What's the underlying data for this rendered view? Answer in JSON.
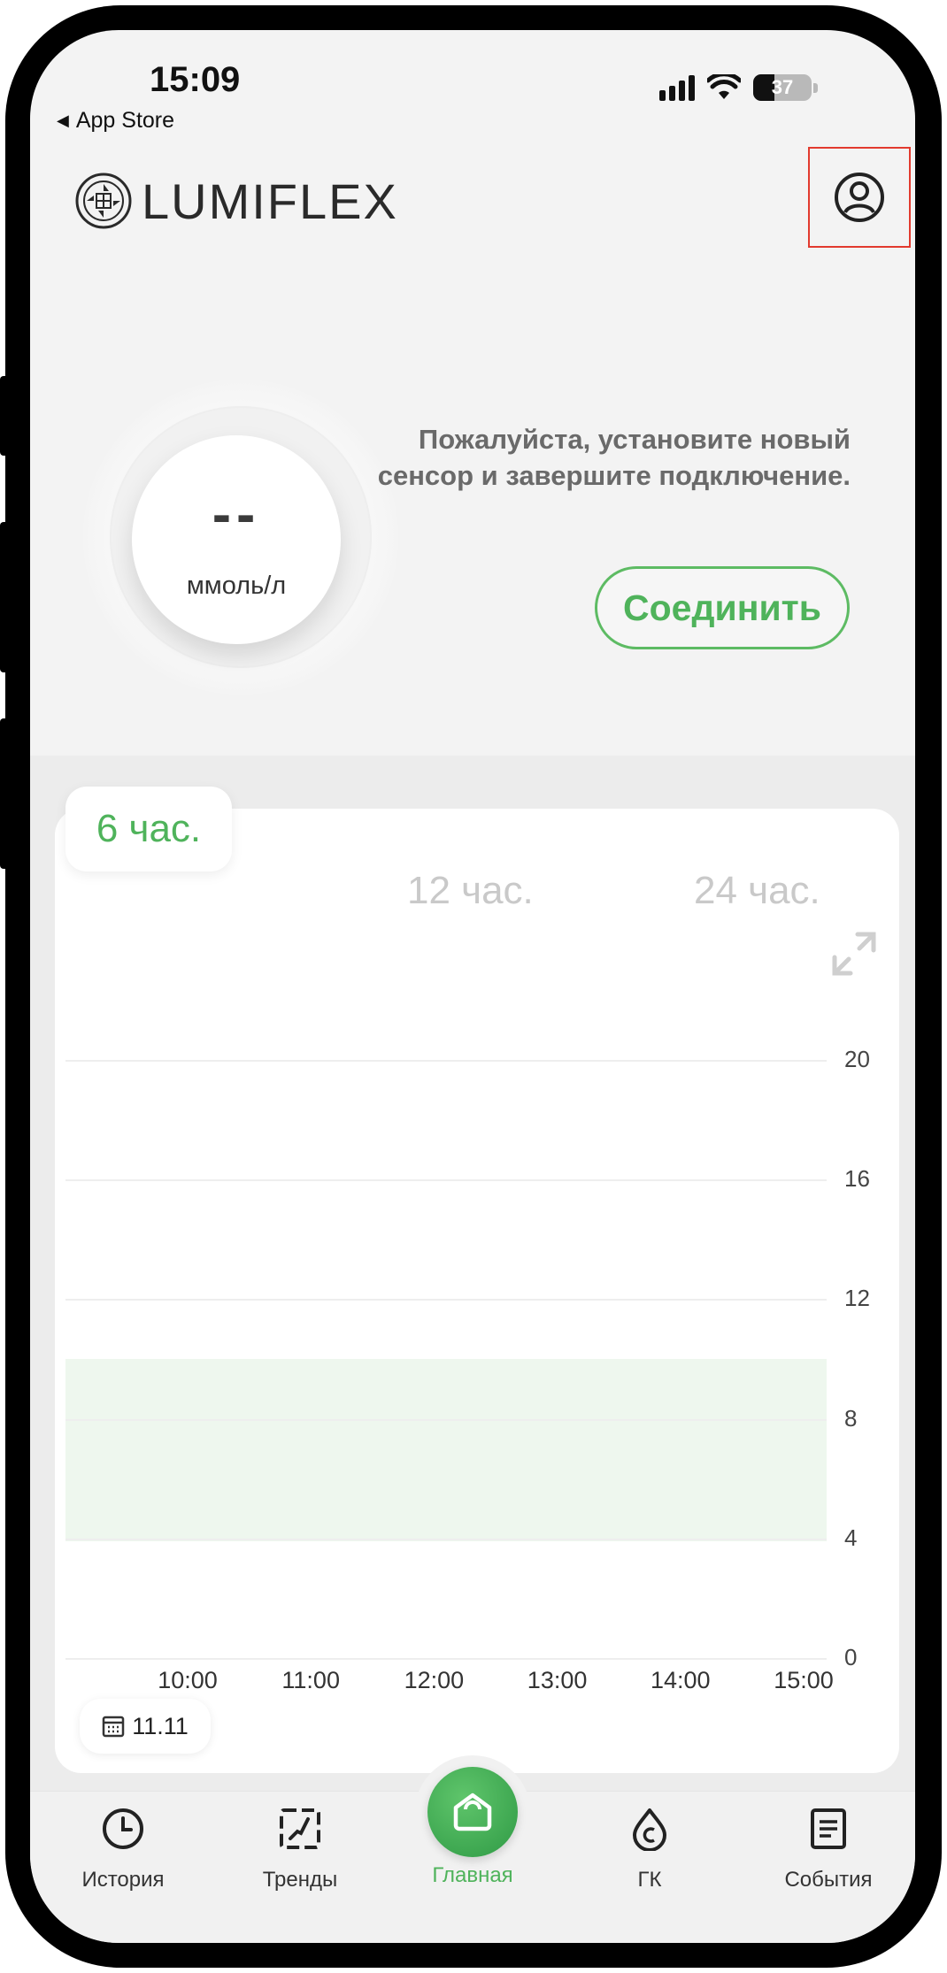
{
  "status_bar": {
    "time": "15:09",
    "back_label": "App Store",
    "battery": "37",
    "battery_level": 0.37
  },
  "header": {
    "logo_text": "LUMIFLEX",
    "profile_icon": "profile-icon"
  },
  "glucose": {
    "value": "--",
    "unit": "ммоль/л"
  },
  "message": {
    "text": "Пожалуйста, установите новый сенсор и завершите подключение."
  },
  "connect_button": {
    "label": "Соединить"
  },
  "range_tabs": [
    {
      "label": "6 час.",
      "active": true
    },
    {
      "label": "12 час.",
      "active": false
    },
    {
      "label": "24 час.",
      "active": false
    }
  ],
  "chart_data": {
    "type": "line",
    "x": [
      "10:00",
      "11:00",
      "12:00",
      "13:00",
      "14:00",
      "15:00"
    ],
    "series": [],
    "ylim": [
      0,
      20
    ],
    "yticks": [
      "20",
      "16",
      "12",
      "8",
      "4",
      "0"
    ],
    "target_range": [
      3.9,
      10.0
    ],
    "grid": true
  },
  "date_chip": {
    "label": "11.11",
    "icon": "calendar-icon"
  },
  "nav": {
    "items": [
      {
        "label": "История",
        "icon": "history-icon"
      },
      {
        "label": "Тренды",
        "icon": "trends-icon"
      },
      {
        "label": "Главная",
        "icon": "home-icon",
        "active": true
      },
      {
        "label": "ГК",
        "icon": "glucose-drop-icon"
      },
      {
        "label": "События",
        "icon": "events-icon"
      }
    ]
  },
  "colors": {
    "accent": "#4fb35b",
    "highlight_border": "#e23a2e",
    "target_band": "#eef7ee"
  }
}
